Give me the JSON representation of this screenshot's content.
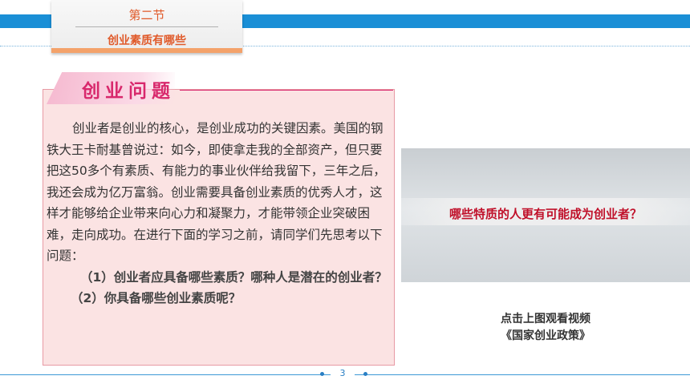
{
  "section": {
    "number": "第二节",
    "title": "创业素质有哪些"
  },
  "problem": {
    "heading": "创业问题",
    "intro": "创业者是创业的核心，是创业成功的关键因素。美国的钢铁大王卡耐基曾说过：如今，即使拿走我的全部资产，但只要把这50多个有素质、有能力的事业伙伴给我留下，三年之后，我还会成为亿万富翁。创业需要具备创业素质的优秀人才，这样才能够给企业带来向心力和凝聚力，才能带领企业突破困难，走向成功。在进行下面的学习之前，请同学们先思考以下问题：",
    "question_1": "（1）创业者应具备哪些素质？哪种人是潜在的创业者？",
    "question_2": "（2）你具备哪些创业素质呢？"
  },
  "video": {
    "question": "哪些特质的人更有可能成为创业者？",
    "caption_1": "点击上图观看视频",
    "caption_2": "《国家创业政策》"
  },
  "footer": {
    "page_number": "3"
  },
  "colors": {
    "accent_blue": "#1a8fd6",
    "heading_pink": "#d8286c",
    "section_orange": "#e05a2a",
    "box_fill": "#fbe3e3"
  }
}
